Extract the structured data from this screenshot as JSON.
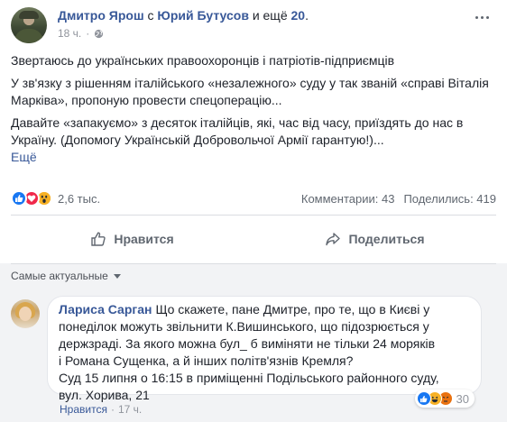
{
  "post": {
    "author": "Дмитро Ярош",
    "with_text": "с",
    "tagged": "Юрий Бутусов",
    "and_text": "и ещё",
    "others_count": "20",
    "others_suffix": ".",
    "time": "18 ч.",
    "separator": "·",
    "privacy_icon": "globe-icon",
    "paragraphs": [
      "Звертаюсь до українських правоохоронців і патріотів-підприємців",
      "У зв'язку з рішенням італійського «незалежного» суду у так званій «справі Віталія Марківа», пропоную провести спецоперацію...",
      "Давайте «запакуємо» з десяток італійців, які, час від часу, приїздять до нас в Україну. (Допомогу Українській Добровольчої Армії гарантую!)..."
    ],
    "see_more": "Ещё"
  },
  "stats": {
    "reaction_icons": [
      "like-icon",
      "love-icon",
      "wow-icon"
    ],
    "reactions_count": "2,6 тыс.",
    "comments": "Комментарии: 43",
    "shares": "Поделились: 419"
  },
  "actions": {
    "like_label": "Нравится",
    "share_label": "Поделиться"
  },
  "comments_section": {
    "sort_label": "Самые актуальные",
    "comment": {
      "author": "Лариса Сарган",
      "lines": [
        "Що скажете, пане Дмитре, про те, що в Києві у",
        "понеділок можуть звільнити К.Вишинського, що підозрюється у",
        "держзраді. За якого можна бул_ б виміняти не тільки 24 моряків",
        "і Романа Сущенка, а й інших політв'язнів Кремля?",
        "Суд 15 липня о 16:15 в приміщенні Подільського районного суду,",
        "вул. Хорива, 21"
      ],
      "reaction_icons": [
        "like-icon",
        "haha-icon",
        "angry-icon"
      ],
      "reactions_count": "30",
      "like_action": "Нравится",
      "separator": "·",
      "time": "17 ч."
    }
  },
  "colors": {
    "link": "#385898",
    "like": "#1877f2",
    "love": "#f0284a",
    "wow": "#f7b125",
    "angry": "#e9710f"
  }
}
